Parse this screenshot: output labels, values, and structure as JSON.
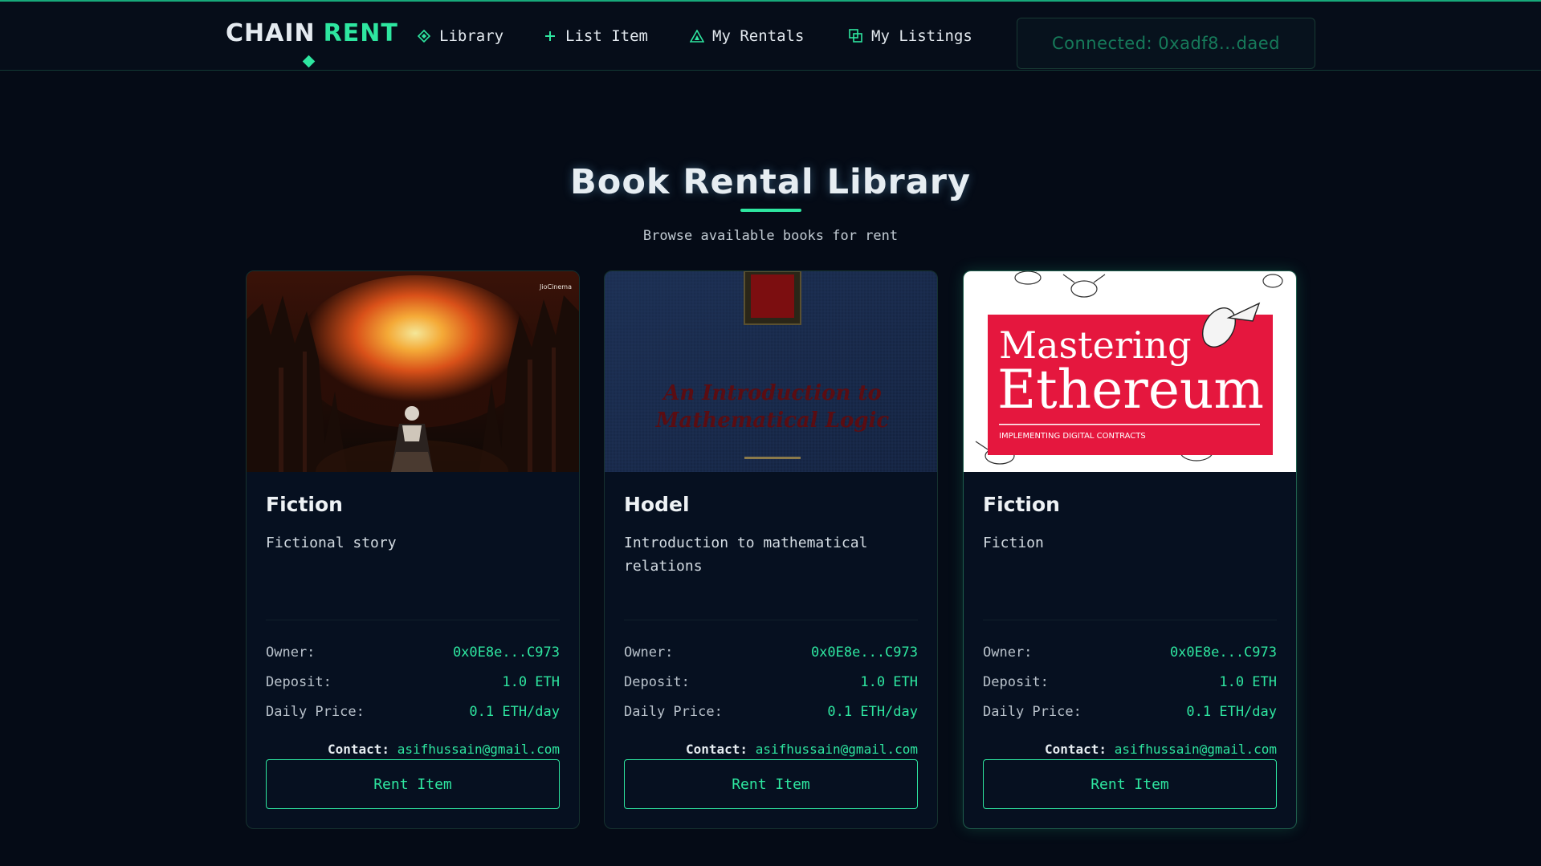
{
  "header": {
    "brand_part1": "CHAIN",
    "brand_part2": "RENT",
    "nav": [
      {
        "label": "Library",
        "icon": "diamond-icon"
      },
      {
        "label": "List Item",
        "icon": "plus-icon"
      },
      {
        "label": "My Rentals",
        "icon": "triangle-icon"
      },
      {
        "label": "My Listings",
        "icon": "copy-icon"
      }
    ],
    "wallet": "Connected: 0xadf8...daed"
  },
  "page": {
    "title": "Book Rental Library",
    "subtitle": "Browse available books for rent"
  },
  "labels": {
    "owner": "Owner:",
    "deposit": "Deposit:",
    "daily_price": "Daily Price:",
    "contact": "Contact:",
    "rent_button": "Rent Item"
  },
  "cards": [
    {
      "title": "Fiction",
      "description": "Fictional story",
      "owner": "0x0E8e...C973",
      "deposit": "1.0 ETH",
      "daily_price": "0.1 ETH/day",
      "contact": "asifhussain@gmail.com",
      "cover_watermark": "JioCinema"
    },
    {
      "title": "Hodel",
      "description": "Introduction to mathematical relations",
      "owner": "0x0E8e...C973",
      "deposit": "1.0 ETH",
      "daily_price": "0.1 ETH/day",
      "contact": "asifhussain@gmail.com",
      "cover_line1": "An Introduction to",
      "cover_line2": "Mathematical Logic"
    },
    {
      "title": "Fiction",
      "description": "Fiction",
      "owner": "0x0E8e...C973",
      "deposit": "1.0 ETH",
      "daily_price": "0.1 ETH/day",
      "contact": "asifhussain@gmail.com",
      "cover_line1": "Mastering",
      "cover_line2": "Ethereum",
      "cover_line3": "IMPLEMENTING DIGITAL CONTRACTS"
    }
  ],
  "colors": {
    "accent": "#2ee6a0",
    "background": "#050b16"
  }
}
